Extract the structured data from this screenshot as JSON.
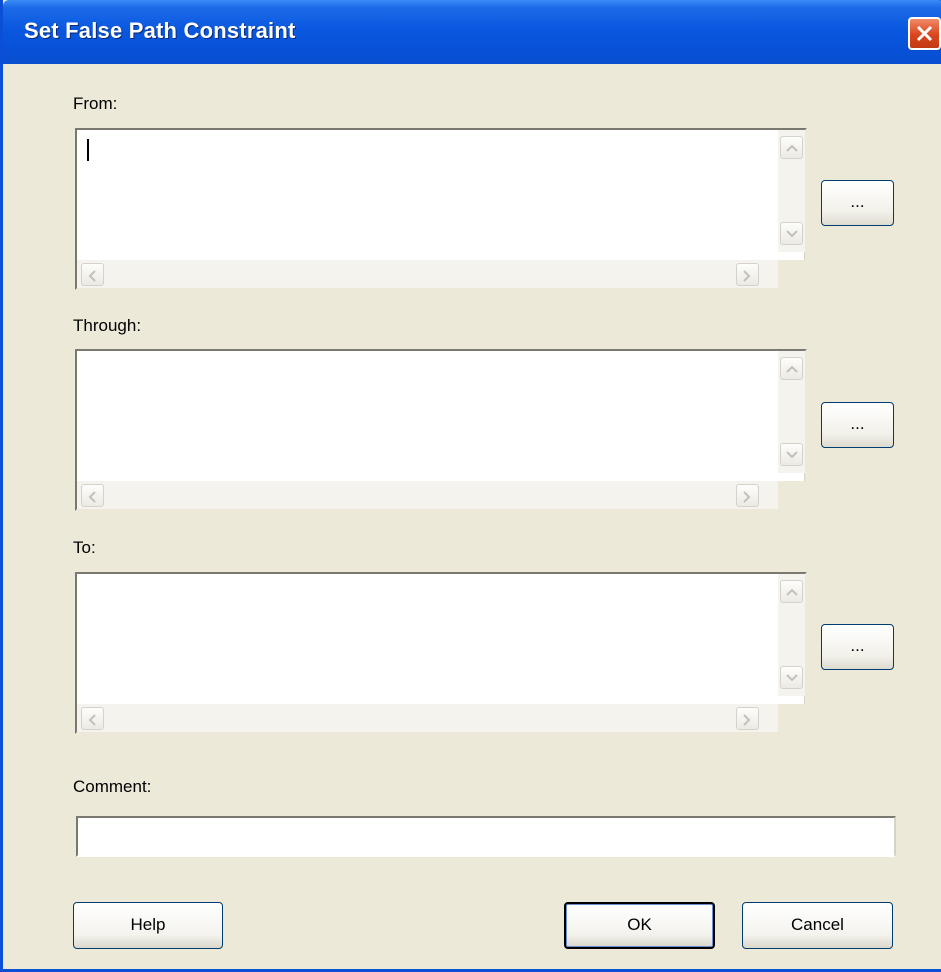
{
  "window": {
    "title": "Set False Path Constraint",
    "close_icon": "close-x-icon"
  },
  "fields": {
    "from_label": "From:",
    "through_label": "Through:",
    "to_label": "To:",
    "comment_label": "Comment:",
    "from_value": "",
    "through_value": "",
    "to_value": "",
    "comment_value": ""
  },
  "buttons": {
    "browse_label": "...",
    "help": "Help",
    "ok": "OK",
    "cancel": "Cancel"
  },
  "colors": {
    "title_bar": "#0a58e0",
    "dialog_bg": "#ece9d8",
    "close_button": "#d9461e"
  }
}
